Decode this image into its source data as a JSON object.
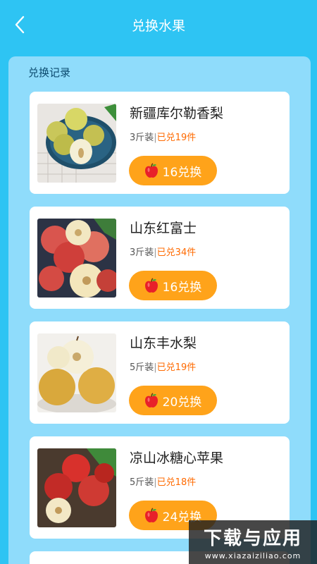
{
  "header": {
    "title": "兑换水果",
    "back_icon": "chevron-left-icon"
  },
  "section": {
    "title": "兑换记录"
  },
  "items": [
    {
      "name": "新疆库尔勒香梨",
      "spec": "3斤装",
      "sep": "|",
      "sold": "已兑19件",
      "cost": "16兑换",
      "image": "pear-plate-image"
    },
    {
      "name": "山东红富士",
      "spec": "3斤装",
      "sep": "|",
      "sold": "已兑34件",
      "cost": "16兑换",
      "image": "red-apples-image"
    },
    {
      "name": "山东丰水梨",
      "spec": "5斤装",
      "sep": "|",
      "sold": "已兑19件",
      "cost": "20兑换",
      "image": "golden-pears-image"
    },
    {
      "name": "凉山冰糖心苹果",
      "spec": "5斤装",
      "sep": "|",
      "sold": "已兑18件",
      "cost": "24兑换",
      "image": "apples-basket-image"
    }
  ],
  "watermark": {
    "big": "下载与应用",
    "small": "www.xiazaiziliao.com"
  },
  "colors": {
    "background": "#2ec4f3",
    "panel": "#8fdcfb",
    "button": "#ffa31a",
    "sold": "#ff6a00"
  }
}
